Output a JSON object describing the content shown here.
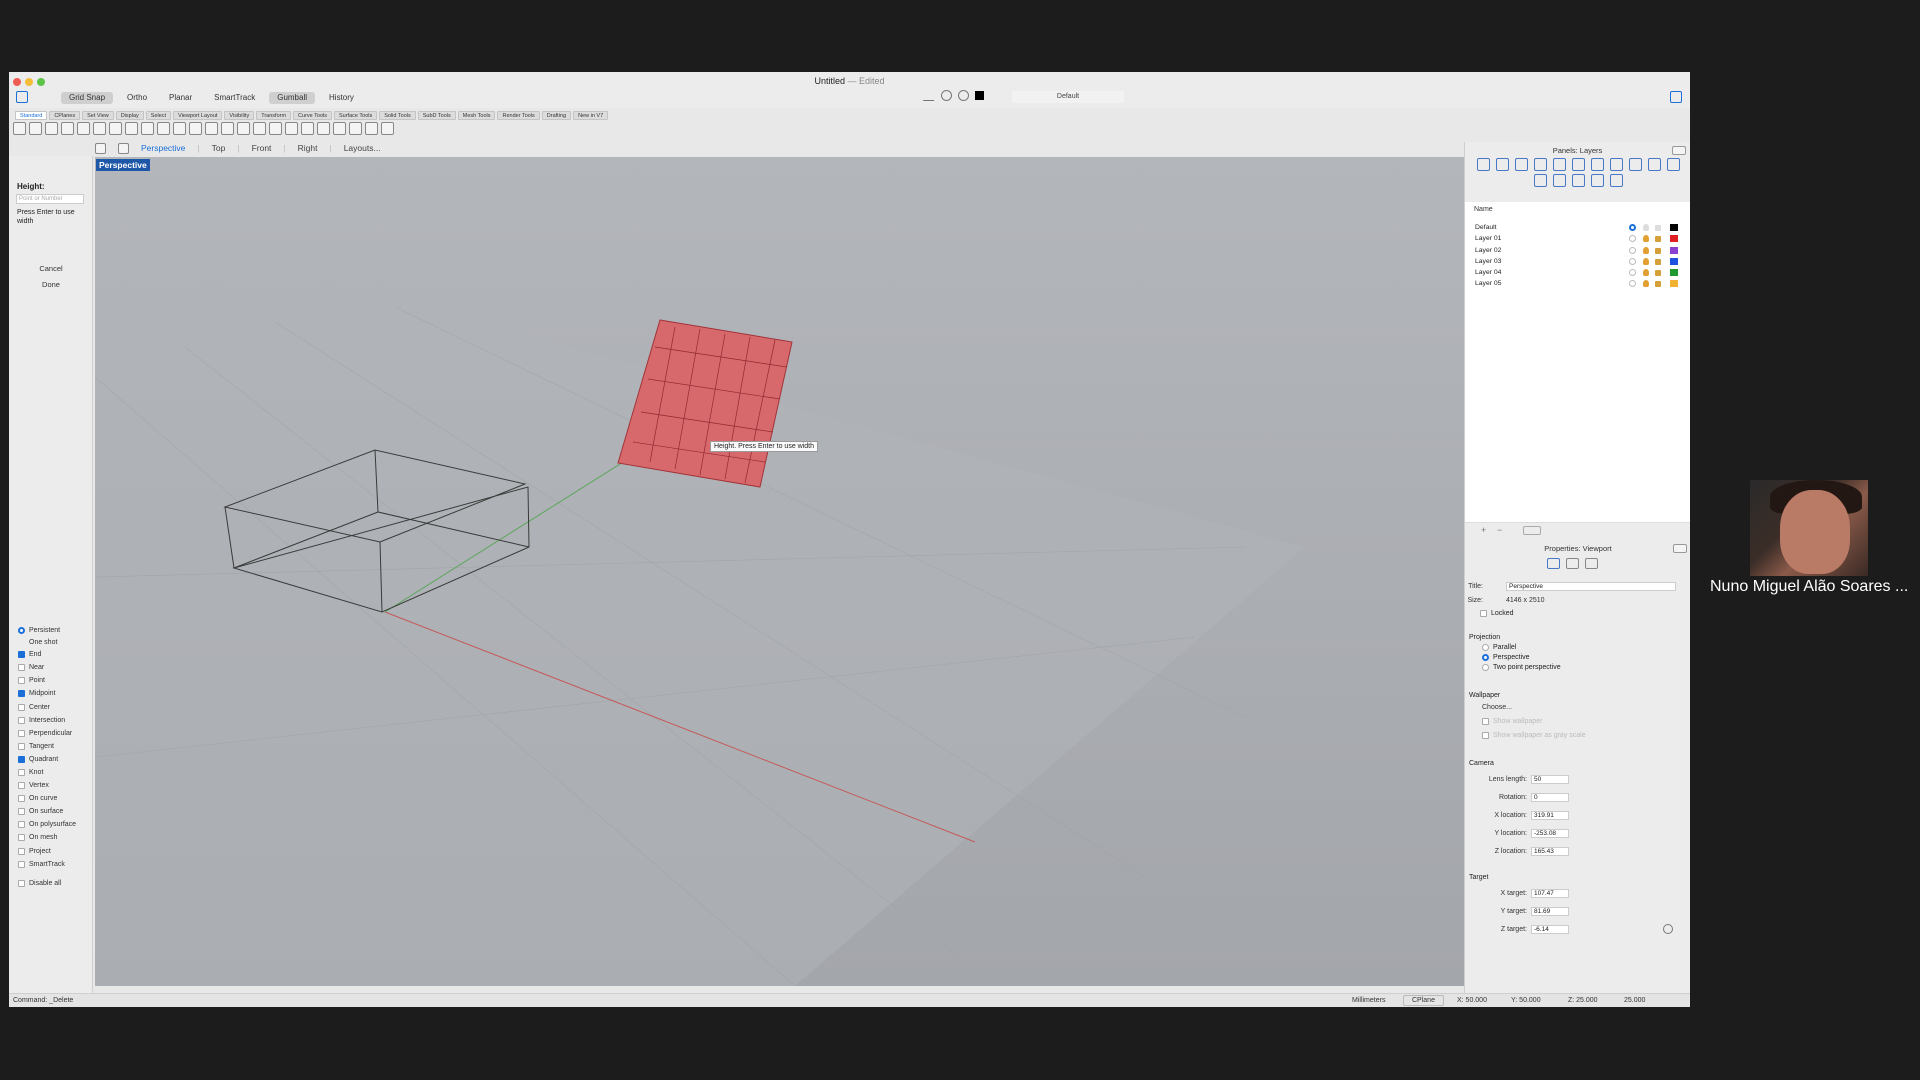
{
  "window": {
    "title": "Untitled",
    "status": "— Edited"
  },
  "modes": [
    {
      "label": "Grid Snap",
      "on": true
    },
    {
      "label": "Ortho",
      "on": false
    },
    {
      "label": "Planar",
      "on": false
    },
    {
      "label": "SmartTrack",
      "on": false
    },
    {
      "label": "Gumball",
      "on": true
    },
    {
      "label": "History",
      "on": false
    }
  ],
  "current_layer": "Default",
  "tabs": [
    "Standard",
    "CPlanes",
    "Set View",
    "Display",
    "Select",
    "Viewport Layout",
    "Visibility",
    "Transform",
    "Curve Tools",
    "Surface Tools",
    "Solid Tools",
    "SubD Tools",
    "Mesh Tools",
    "Render Tools",
    "Drafting",
    "New in V7"
  ],
  "viewport_tabs": [
    "Perspective",
    "Top",
    "Front",
    "Right",
    "Layouts..."
  ],
  "command_panel": {
    "prompt": "Height:",
    "placeholder": "Point or Number",
    "hint": "Press Enter to use width",
    "cancel": "Cancel",
    "done": "Done"
  },
  "osnaps": {
    "persistent": "Persistent",
    "one_shot": "One shot",
    "items": [
      {
        "label": "End",
        "on": true
      },
      {
        "label": "Near",
        "on": false
      },
      {
        "label": "Point",
        "on": false
      },
      {
        "label": "Midpoint",
        "on": true
      },
      {
        "label": "Center",
        "on": false
      },
      {
        "label": "Intersection",
        "on": false
      },
      {
        "label": "Perpendicular",
        "on": false
      },
      {
        "label": "Tangent",
        "on": false
      },
      {
        "label": "Quadrant",
        "on": true
      },
      {
        "label": "Knot",
        "on": false
      },
      {
        "label": "Vertex",
        "on": false
      },
      {
        "label": "On curve",
        "on": false
      },
      {
        "label": "On surface",
        "on": false
      },
      {
        "label": "On polysurface",
        "on": false
      },
      {
        "label": "On mesh",
        "on": false
      },
      {
        "label": "Project",
        "on": false
      },
      {
        "label": "SmartTrack",
        "on": false
      }
    ],
    "disable_all": "Disable all"
  },
  "viewport": {
    "label": "Perspective",
    "tooltip": "Height. Press Enter to use width"
  },
  "layers_panel": {
    "title": "Panels: Layers",
    "column_name": "Name",
    "layers": [
      {
        "name": "Default",
        "color": "#000000",
        "current": true
      },
      {
        "name": "Layer 01",
        "color": "#e02020",
        "current": false
      },
      {
        "name": "Layer 02",
        "color": "#8a3fd0",
        "current": false
      },
      {
        "name": "Layer 03",
        "color": "#2050e0",
        "current": false
      },
      {
        "name": "Layer 04",
        "color": "#1f9a30",
        "current": false
      },
      {
        "name": "Layer 05",
        "color": "#f0b030",
        "current": false
      }
    ]
  },
  "properties": {
    "title": "Properties: Viewport",
    "title_label": "Title:",
    "title_value": "Perspective",
    "size_label": "Size:",
    "size_value": "4146 x 2510",
    "locked": "Locked",
    "projection": "Projection",
    "parallel": "Parallel",
    "perspective": "Perspective",
    "two_point": "Two point perspective",
    "wallpaper": "Wallpaper",
    "choose": "Choose...",
    "show_wallpaper": "Show wallpaper",
    "show_gray": "Show wallpaper as gray scale",
    "camera": "Camera",
    "lens_label": "Lens length:",
    "lens_value": "50",
    "rotation_label": "Rotation:",
    "rotation_value": "0",
    "xloc_label": "X location:",
    "xloc_value": "319.91",
    "yloc_label": "Y location:",
    "yloc_value": "-253.08",
    "zloc_label": "Z location:",
    "zloc_value": "165.43",
    "target": "Target",
    "xt_label": "X target:",
    "xt_value": "107.47",
    "yt_label": "Y target:",
    "yt_value": "81.69",
    "zt_label": "Z target:",
    "zt_value": "-6.14"
  },
  "status": {
    "command": "Command: _Delete",
    "units": "Millimeters",
    "cplane": "CPlane",
    "x": "X: 50.000",
    "y": "Y: 50.000",
    "z": "Z: 25.000",
    "value": "25.000"
  },
  "participant": {
    "name": "Nuno Miguel Alão Soares ..."
  }
}
